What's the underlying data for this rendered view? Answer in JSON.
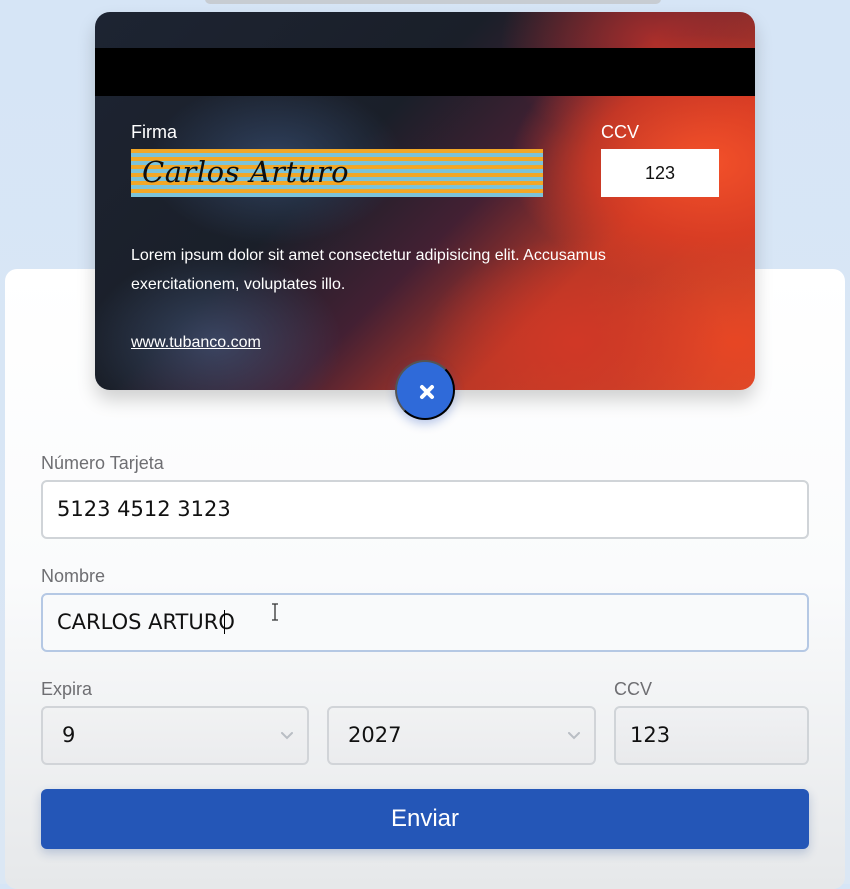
{
  "card": {
    "signature_label": "Firma",
    "signature": "Carlos Arturo",
    "ccv_label": "CCV",
    "ccv_value": "123",
    "legal_text": "Lorem ipsum dolor sit amet consectetur adipisicing elit. Accusamus exercitationem, voluptates illo.",
    "bank_url": "www.tubanco.com",
    "stripe_colors": [
      "#f2a727",
      "#7cc3da"
    ]
  },
  "actions": {
    "flip_icon": "close-icon"
  },
  "form": {
    "number_label": "Número Tarjeta",
    "number_value": "5123 4512 3123",
    "name_label": "Nombre",
    "name_value": "CARLOS ARTURO",
    "expiry_label": "Expira",
    "month_value": "9",
    "year_value": "2027",
    "ccv_label": "CCV",
    "ccv_value": "123",
    "submit_label": "Enviar"
  },
  "colors": {
    "accent": "#2456b7",
    "flip_button": "#2f6ad9"
  }
}
